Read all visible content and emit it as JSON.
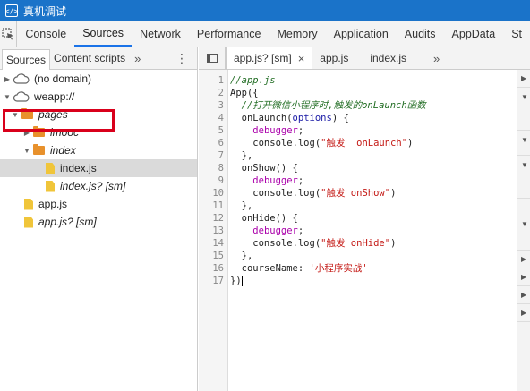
{
  "titlebar": {
    "icon": "code-brackets-icon",
    "icon_glyph": "</>",
    "title": "真机调试"
  },
  "panel_tabs": [
    "Console",
    "Sources",
    "Network",
    "Performance",
    "Memory",
    "Application",
    "Audits",
    "AppData",
    "St"
  ],
  "panel_tabs_active": "Sources",
  "navigator": {
    "tabs": [
      "Sources",
      "Content scripts"
    ],
    "more": "»",
    "kebab": "⋮",
    "tree": {
      "no_domain": "(no domain)",
      "weapp": "weapp://",
      "pages": "pages",
      "imooc": "imooc",
      "index_folder": "index",
      "index_js": "index.js",
      "index_js_sm": "index.js? [sm]",
      "app_js": "app.js",
      "app_js_sm": "app.js? [sm]"
    }
  },
  "editor": {
    "tabs": [
      {
        "label": "app.js? [sm]",
        "close": "×"
      },
      {
        "label": "app.js"
      },
      {
        "label": "index.js"
      }
    ],
    "more": "»",
    "line_numbers": [
      "1",
      "2",
      "3",
      "4",
      "5",
      "6",
      "7",
      "8",
      "9",
      "10",
      "11",
      "12",
      "13",
      "14",
      "15",
      "16",
      "17"
    ],
    "code": {
      "l1": "//app.js",
      "l2a": "App",
      "l2b": "({",
      "l3": "  //打开微信小程序时,触发的onLaunch函数",
      "l4a": "  onLaunch(",
      "l4b": "options",
      "l4c": ") {",
      "l5": "debugger",
      "l5b": ";",
      "l6a": "    console.log(",
      "l6b": "\"触发  onLaunch\"",
      "l6c": ")",
      "l7": "  },",
      "l8": "  onShow() {",
      "l9": "debugger",
      "l9b": ";",
      "l10a": "    console.log(",
      "l10b": "\"触发 onShow\"",
      "l10c": ")",
      "l11": "  },",
      "l12": "  onHide() {",
      "l13": "debugger",
      "l13b": ";",
      "l14a": "    console.log(",
      "l14b": "\"触发 onHide\"",
      "l14c": ")",
      "l15": "  },",
      "l16a": "  courseName: ",
      "l16b": "'小程序实战'",
      "l17": "})"
    }
  },
  "colors": {
    "titlebar": "#1a73c9",
    "highlight_box": "#d9001b",
    "folder": "#e8912c",
    "file": "#f0c53a"
  }
}
